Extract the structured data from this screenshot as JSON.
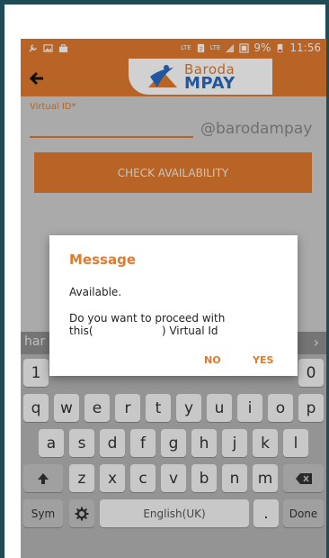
{
  "status_bar": {
    "battery": "9%",
    "time": "11:56",
    "network_1": "LTE",
    "network_2": "LTE"
  },
  "app": {
    "logo_line1": "Baroda",
    "logo_line2": "MPAY",
    "accent_color": "#e07a2f",
    "brand_blue": "#2a6ac2"
  },
  "form": {
    "virtual_id_label": "Virtual ID*",
    "virtual_id_value": "",
    "virtual_id_suffix": "@barodampay",
    "check_button": "CHECK AVAILABILITY"
  },
  "dialog": {
    "title": "Message",
    "line_available": "Available.",
    "question_line1": "Do you want to proceed with",
    "question_line2": "this(                    ) Virtual Id",
    "no_label": "NO",
    "yes_label": "YES"
  },
  "keyboard": {
    "suggestion": "har",
    "row_numbers": [
      "1",
      "0"
    ],
    "row1": [
      "q",
      "w",
      "e",
      "r",
      "t",
      "y",
      "u",
      "i",
      "o",
      "p"
    ],
    "row2": [
      "a",
      "s",
      "d",
      "f",
      "g",
      "h",
      "j",
      "k",
      "l"
    ],
    "row3": [
      "z",
      "x",
      "c",
      "v",
      "b",
      "n",
      "m"
    ],
    "sym": "Sym",
    "space": "English(UK)",
    "period": ".",
    "done": "Done"
  }
}
